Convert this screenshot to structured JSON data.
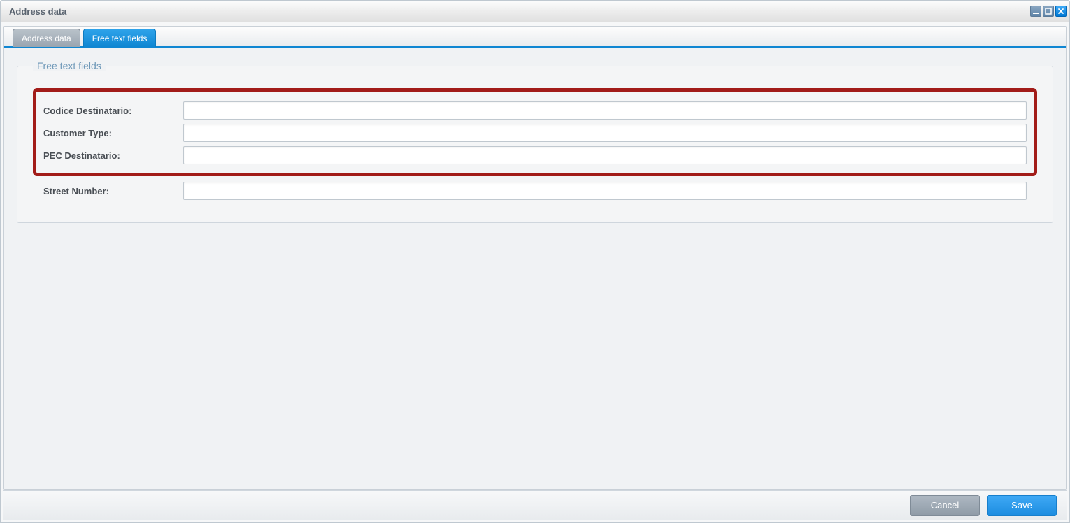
{
  "window": {
    "title": "Address data"
  },
  "tabs": {
    "address_data": "Address data",
    "free_text_fields": "Free text fields"
  },
  "fieldset": {
    "legend": "Free text fields"
  },
  "fields": {
    "codice_destinatario": {
      "label": "Codice Destinatario:",
      "value": ""
    },
    "customer_type": {
      "label": "Customer Type:",
      "value": ""
    },
    "pec_destinatario": {
      "label": "PEC Destinatario:",
      "value": ""
    },
    "street_number": {
      "label": "Street Number:",
      "value": ""
    }
  },
  "footer": {
    "cancel": "Cancel",
    "save": "Save"
  }
}
